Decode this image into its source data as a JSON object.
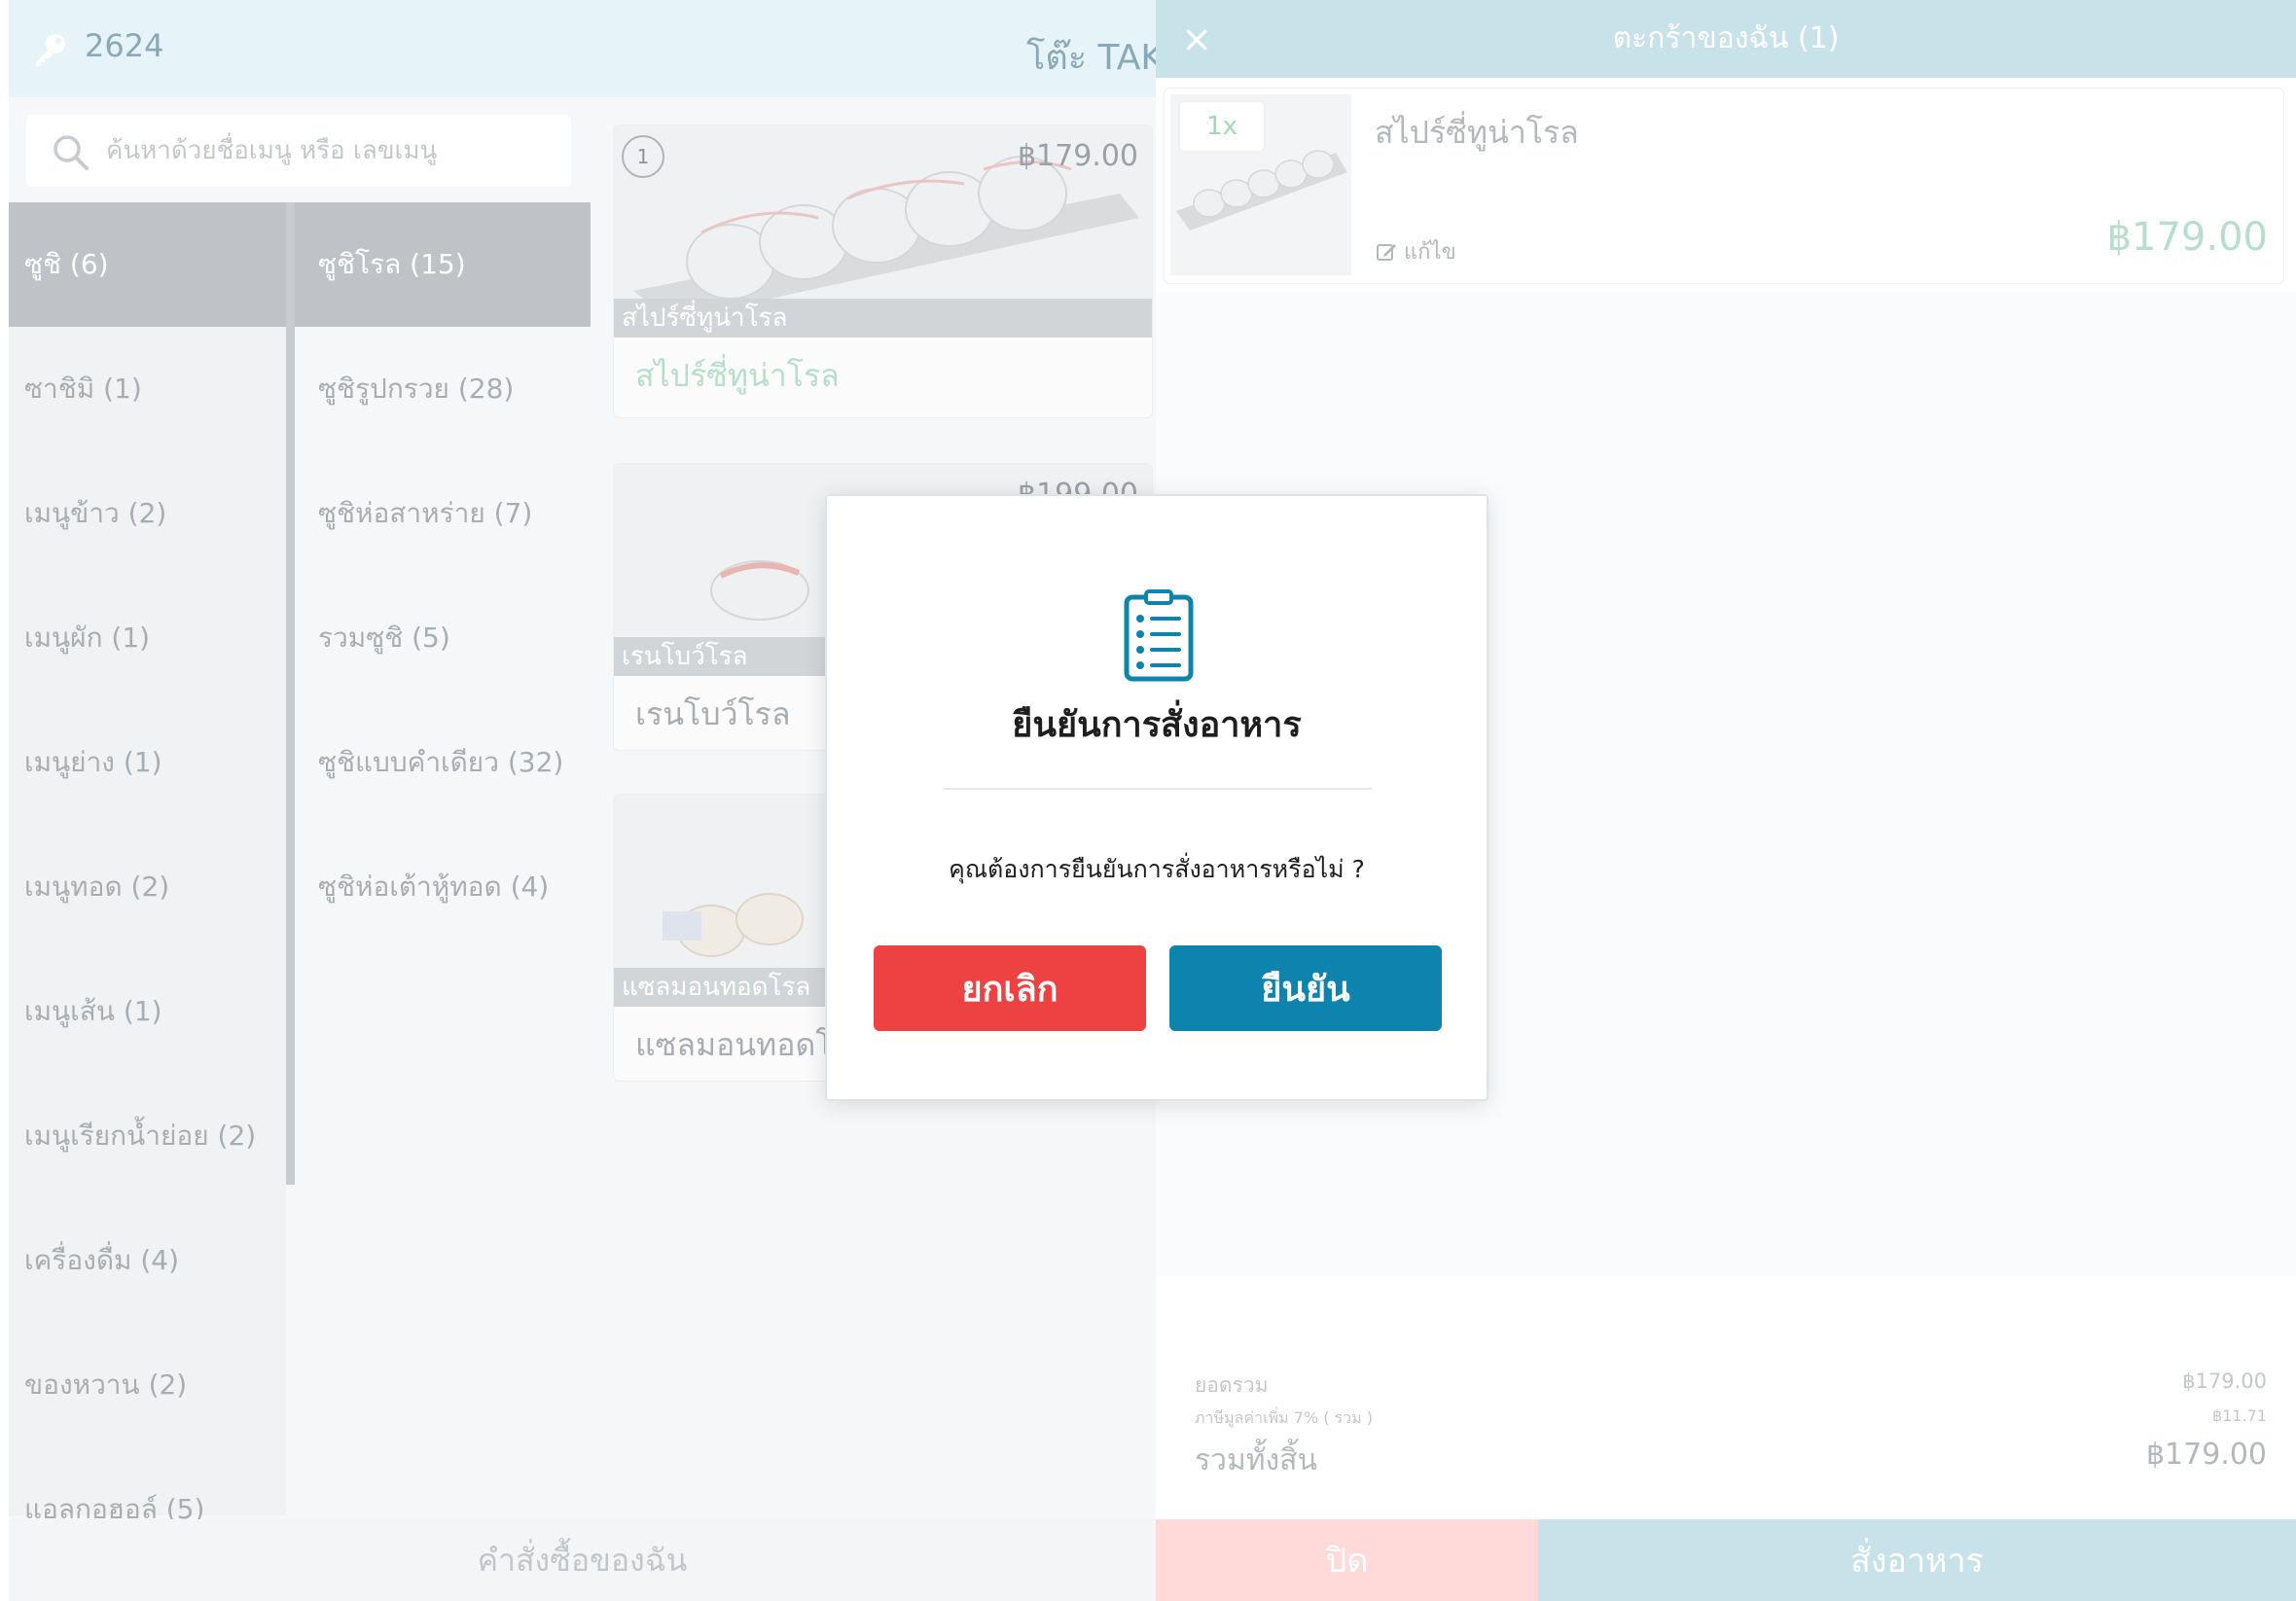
{
  "header": {
    "order_number": "2624",
    "table_label": "โต๊ะ TAKE"
  },
  "search": {
    "placeholder": "ค้นหาด้วยชื่อเมนู หรือ เลขเมนู"
  },
  "categories": [
    {
      "label": "ซูชิ (6)",
      "active": true
    },
    {
      "label": "ซาชิมิ (1)",
      "active": false
    },
    {
      "label": "เมนูข้าว (2)",
      "active": false
    },
    {
      "label": "เมนูผัก (1)",
      "active": false
    },
    {
      "label": "เมนูย่าง (1)",
      "active": false
    },
    {
      "label": "เมนูทอด (2)",
      "active": false
    },
    {
      "label": "เมนูเส้น (1)",
      "active": false
    },
    {
      "label": "เมนูเรียกน้ำย่อย (2)",
      "active": false
    },
    {
      "label": "เครื่องดื่ม (4)",
      "active": false
    },
    {
      "label": "ของหวาน (2)",
      "active": false
    },
    {
      "label": "แอลกอฮอล์ (5)",
      "active": false
    }
  ],
  "subcategories": [
    {
      "label": "ซูชิโรล (15)",
      "active": true
    },
    {
      "label": "ซูชิรูปกรวย (28)",
      "active": false
    },
    {
      "label": "ซูชิห่อสาหร่าย (7)",
      "active": false
    },
    {
      "label": "รวมซูชิ (5)",
      "active": false
    },
    {
      "label": "ซูชิแบบคำเดียว (32)",
      "active": false
    },
    {
      "label": "ซูชิห่อเต้าหู้ทอด (4)",
      "active": false
    }
  ],
  "products": [
    {
      "badge": "1",
      "price": "฿179.00",
      "strip": "สไปร์ซี่ทูน่าโรล",
      "name": "สไปร์ซี่ทูน่าโรล"
    },
    {
      "badge": "",
      "price": "฿199.00",
      "strip": "เรนโบว์โรล",
      "name": "เรนโบว์โรล"
    },
    {
      "badge": "",
      "price": "",
      "strip": "แซลมอนทอดโรล",
      "name": "แซลมอนทอดโรล"
    }
  ],
  "footer_left": {
    "my_orders_label": "คำสั่งซื้อของฉัน"
  },
  "cart": {
    "title": "ตะกร้าของฉัน (1)",
    "close_glyph": "×",
    "item": {
      "qty": "1x",
      "name": "สไปร์ซี่ทูน่าโรล",
      "edit_label": "แก้ไข",
      "price": "฿179.00"
    },
    "summary": {
      "subtotal_label": "ยอดรวม",
      "subtotal_value": "฿179.00",
      "vat_label": "ภาษีมูลค่าเพิ่ม 7% ( รวม )",
      "vat_value": "฿11.71",
      "total_label": "รวมทั้งสิ้น",
      "total_value": "฿179.00"
    },
    "close_button_label": "ปิด",
    "order_button_label": "สั่งอาหาร"
  },
  "modal": {
    "title": "ยืนยันการสั่งอาหาร",
    "message": "คุณต้องการยืนยันการสั่งอาหารหรือไม่ ?",
    "cancel_label": "ยกเลิก",
    "confirm_label": "ยืนยัน"
  },
  "colors": {
    "accent": "#0e83ae",
    "danger": "#ec4242",
    "cart_header": "#c8e2ea",
    "price_green": "#b6deca"
  },
  "icons": {
    "key": "key-icon",
    "search": "search-icon",
    "close": "close-icon",
    "edit": "edit-icon",
    "clipboard": "clipboard-list-icon"
  }
}
